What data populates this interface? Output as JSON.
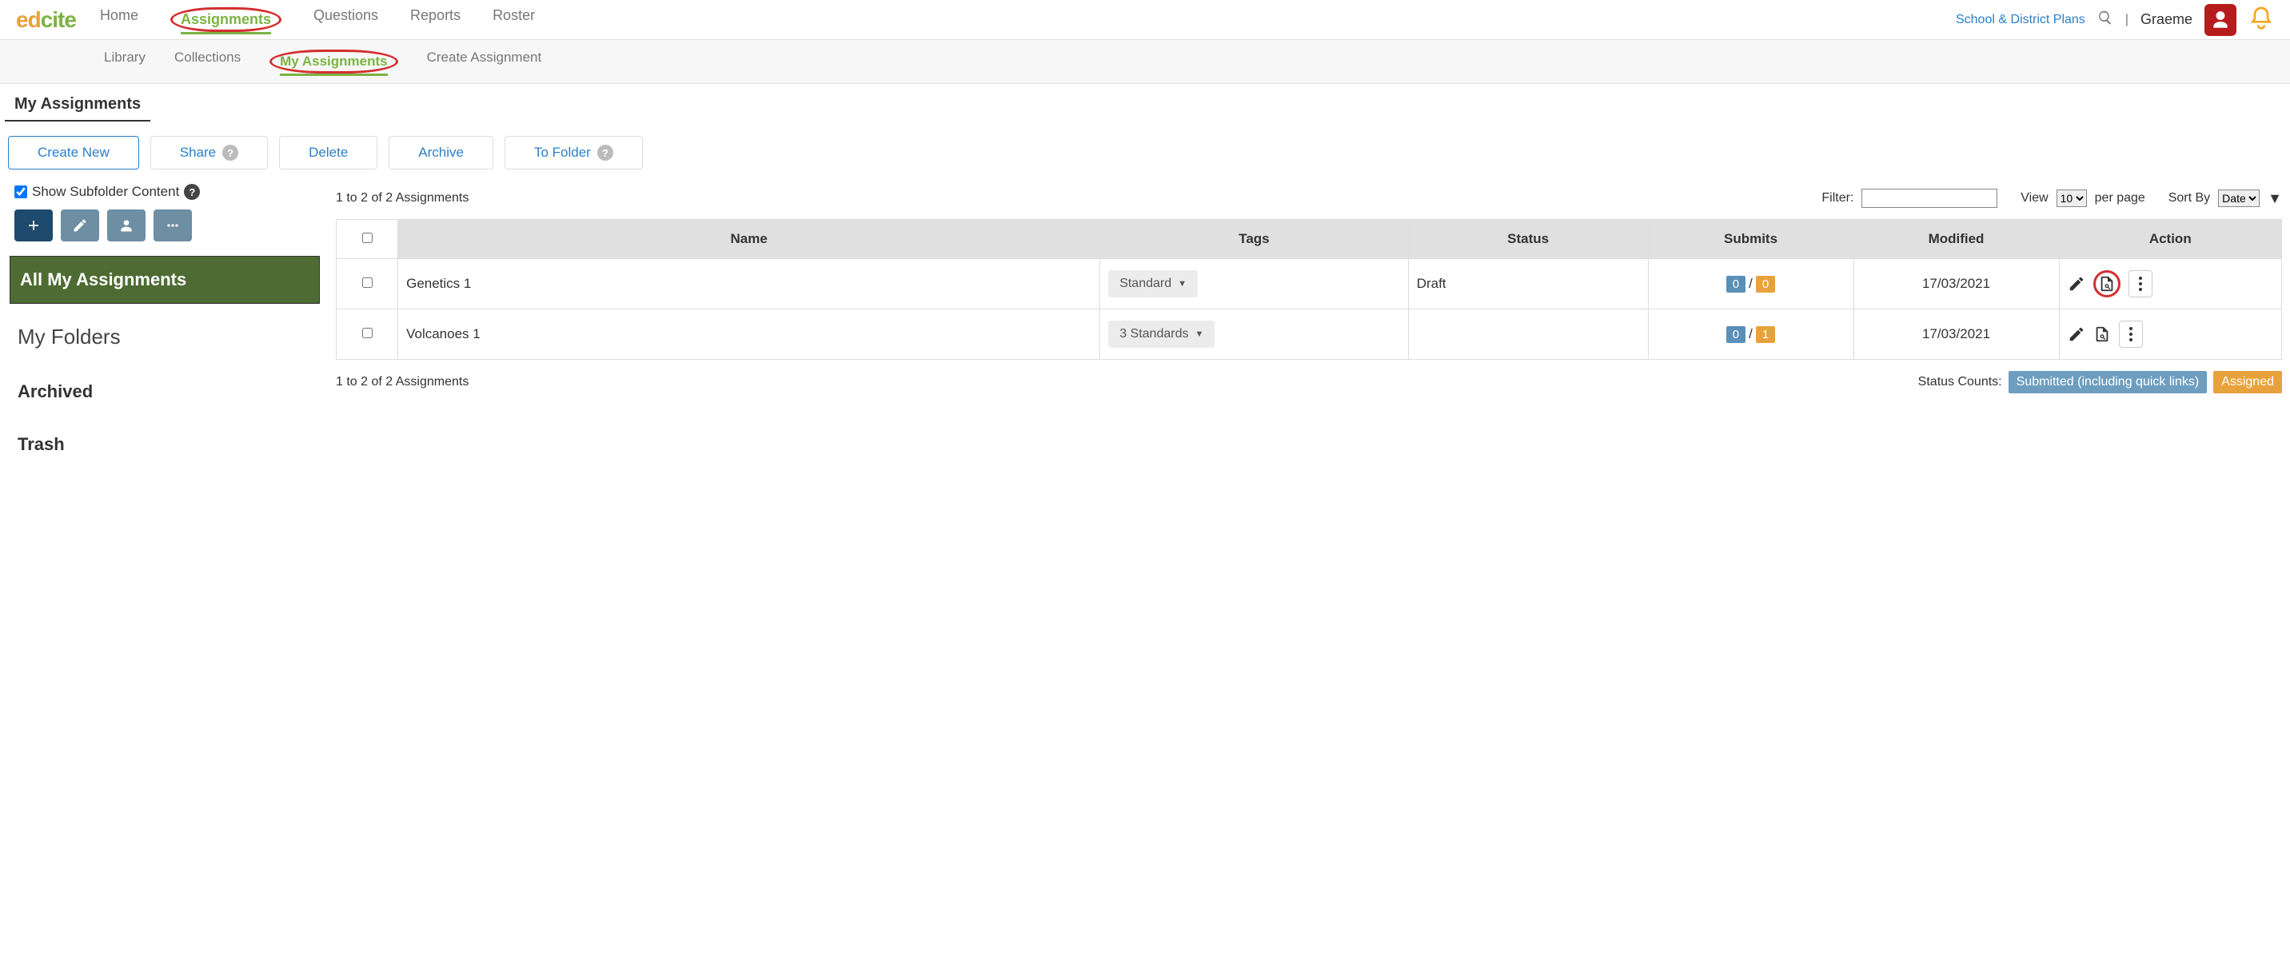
{
  "logo": {
    "part1": "ed",
    "part2": "cite"
  },
  "nav": {
    "home": "Home",
    "assignments": "Assignments",
    "questions": "Questions",
    "reports": "Reports",
    "roster": "Roster",
    "plans": "School & District Plans",
    "username": "Graeme"
  },
  "subnav": {
    "library": "Library",
    "collections": "Collections",
    "my_assignments": "My Assignments",
    "create": "Create Assignment"
  },
  "page_title": "My Assignments",
  "buttons": {
    "create_new": "Create New",
    "share": "Share",
    "delete": "Delete",
    "archive": "Archive",
    "to_folder": "To Folder"
  },
  "sidebar": {
    "show_subfolder": "Show Subfolder Content",
    "all": "All My Assignments",
    "folders": "My Folders",
    "archived": "Archived",
    "trash": "Trash"
  },
  "list": {
    "summary_top": "1 to 2 of 2 Assignments",
    "summary_bottom": "1 to 2 of 2 Assignments",
    "filter_label": "Filter:",
    "view_label": "View",
    "per_page_value": "10",
    "per_page_suffix": "per page",
    "sort_label": "Sort By",
    "sort_value": "Date"
  },
  "table": {
    "headers": {
      "name": "Name",
      "tags": "Tags",
      "status": "Status",
      "submits": "Submits",
      "modified": "Modified",
      "action": "Action"
    },
    "rows": [
      {
        "name": "Genetics 1",
        "tag": "Standard",
        "status": "Draft",
        "submits_a": "0",
        "submits_b": "0",
        "modified": "17/03/2021",
        "circled": true
      },
      {
        "name": "Volcanoes 1",
        "tag": "3 Standards",
        "status": "",
        "submits_a": "0",
        "submits_b": "1",
        "modified": "17/03/2021",
        "circled": false
      }
    ]
  },
  "footer": {
    "status_counts_label": "Status Counts:",
    "submitted": "Submitted (including quick links)",
    "assigned": "Assigned"
  }
}
